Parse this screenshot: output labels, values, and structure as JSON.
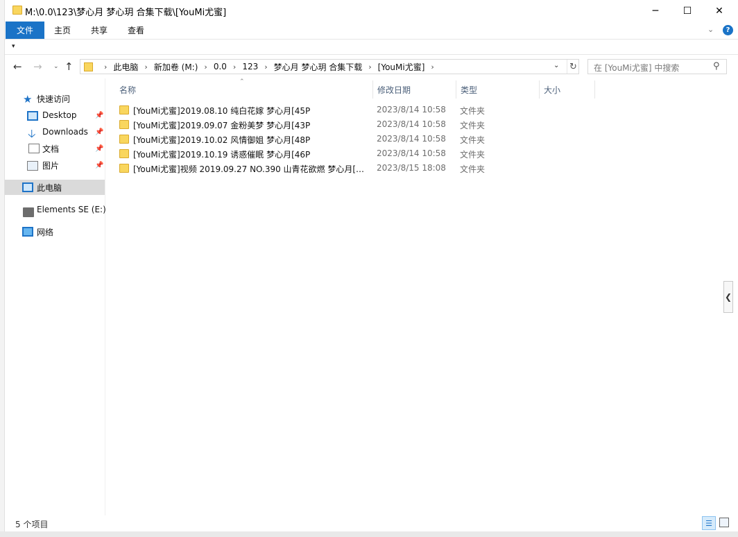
{
  "window": {
    "title": "M:\\0.0\\123\\梦心月 梦心玥 合集下载\\[YouMi尤蜜]",
    "minimize": "─",
    "maximize": "☐",
    "close": "✕"
  },
  "ribbon": {
    "tabs": [
      "文件",
      "主页",
      "共享",
      "查看"
    ],
    "expand_icon": "chevron-down-icon",
    "help": "?"
  },
  "qat": {
    "customize": "▾"
  },
  "address": {
    "crumbs": [
      "此电脑",
      "新加卷 (M:)",
      "0.0",
      "123",
      "梦心月 梦心玥 合集下载",
      "[YouMi尤蜜]"
    ],
    "search_placeholder": "在 [YouMi尤蜜] 中搜索"
  },
  "nav_pane": {
    "quick_access": "快速访问",
    "items": [
      {
        "label": "Desktop",
        "icon": "desktop-icon",
        "pinned": true
      },
      {
        "label": "Downloads",
        "icon": "download-icon",
        "pinned": true
      },
      {
        "label": "文档",
        "icon": "document-icon",
        "pinned": true
      },
      {
        "label": "图片",
        "icon": "picture-icon",
        "pinned": true
      }
    ],
    "this_pc": "此电脑",
    "drive": "Elements SE (E:)",
    "network": "网络"
  },
  "columns": {
    "name": "名称",
    "date": "修改日期",
    "type": "类型",
    "size": "大小"
  },
  "files": [
    {
      "name": "[YouMi尤蜜]2019.08.10 纯白花嫁 梦心月[45P",
      "date": "2023/8/14 10:58",
      "type": "文件夹"
    },
    {
      "name": "[YouMi尤蜜]2019.09.07 金粉美梦 梦心月[43P",
      "date": "2023/8/14 10:58",
      "type": "文件夹"
    },
    {
      "name": "[YouMi尤蜜]2019.10.02 风情御姐 梦心月[48P",
      "date": "2023/8/14 10:58",
      "type": "文件夹"
    },
    {
      "name": "[YouMi尤蜜]2019.10.19 诱惑催眠 梦心月[46P",
      "date": "2023/8/14 10:58",
      "type": "文件夹"
    },
    {
      "name": "[YouMi尤蜜]视频 2019.09.27 NO.390 山青花欲燃 梦心月[1...",
      "date": "2023/8/15 18:08",
      "type": "文件夹"
    }
  ],
  "status": {
    "count": "5 个项目"
  },
  "colors": {
    "accent": "#1a73c7",
    "folder": "#f9d65e",
    "selection": "#dadada"
  }
}
